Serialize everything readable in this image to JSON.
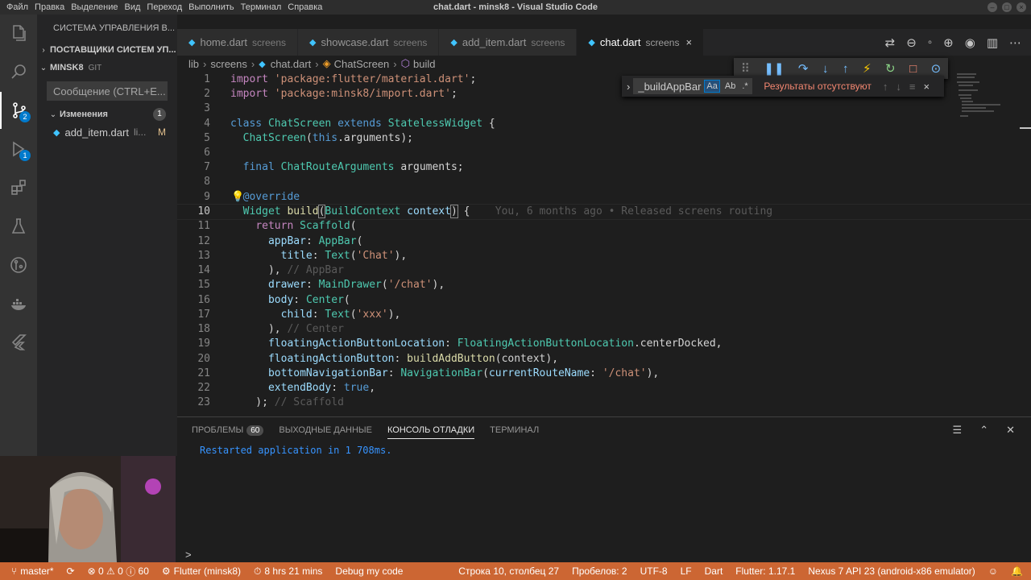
{
  "window": {
    "title": "chat.dart - minsk8 - Visual Studio Code",
    "menu": [
      "Файл",
      "Правка",
      "Выделение",
      "Вид",
      "Переход",
      "Выполнить",
      "Терминал",
      "Справка"
    ],
    "controls": [
      "–",
      "□",
      "×"
    ]
  },
  "activity_bar": {
    "scm_badge": "2",
    "debug_badge": "1"
  },
  "sidebar": {
    "header": "СИСТЕМА УПРАВЛЕНИЯ В...",
    "providers": "ПОСТАВЩИКИ СИСТЕМ УП...",
    "repo_name": "MINSK8",
    "repo_type": "GIT",
    "commit_placeholder": "Сообщение (CTRL+E...",
    "changes_label": "Изменения",
    "changes_count": "1",
    "changed_file": {
      "name": "add_item.dart",
      "path": "li...",
      "status": "M"
    }
  },
  "tabs": [
    {
      "name": "home.dart",
      "desc": "screens"
    },
    {
      "name": "showcase.dart",
      "desc": "screens"
    },
    {
      "name": "add_item.dart",
      "desc": "screens"
    },
    {
      "name": "chat.dart",
      "desc": "screens",
      "close": "×"
    }
  ],
  "breadcrumb": [
    "lib",
    "screens",
    "chat.dart",
    "ChatScreen",
    "build"
  ],
  "find": {
    "query": "_buildAppBar",
    "opt_case": "Aa",
    "opt_word": "Ab",
    "opt_regex": ".*",
    "result": "Результаты отсутствуют"
  },
  "editor": {
    "current_line": "10",
    "blame": "You, 6 months ago • Released screens routing",
    "line_numbers": [
      "1",
      "2",
      "3",
      "4",
      "5",
      "6",
      "7",
      "8",
      "9",
      "10",
      "11",
      "12",
      "13",
      "14",
      "15",
      "16",
      "17",
      "18",
      "19",
      "20",
      "21",
      "22",
      "23"
    ]
  },
  "panel": {
    "tabs": [
      "ПРОБЛЕМЫ",
      "ВЫХОДНЫЕ ДАННЫЕ",
      "КОНСОЛЬ ОТЛАДКИ",
      "ТЕРМИНАЛ"
    ],
    "problems_count": "60",
    "output": "Restarted application in 1 708ms.",
    "prompt": ">"
  },
  "statusbar": {
    "branch": "master*",
    "errors": "0",
    "warnings": "0",
    "infos": "60",
    "flutter_project": "Flutter (minsk8)",
    "time": "8 hrs 21 mins",
    "debug": "Debug my code",
    "position": "Строка 10, столбец 27",
    "spaces": "Пробелов: 2",
    "encoding": "UTF-8",
    "eol": "LF",
    "language": "Dart",
    "flutter_version": "Flutter: 1.17.1",
    "device": "Nexus 7 API 23 (android-x86 emulator)"
  },
  "colors": {
    "statusbar": "#cc6633",
    "accent": "#007acc"
  }
}
